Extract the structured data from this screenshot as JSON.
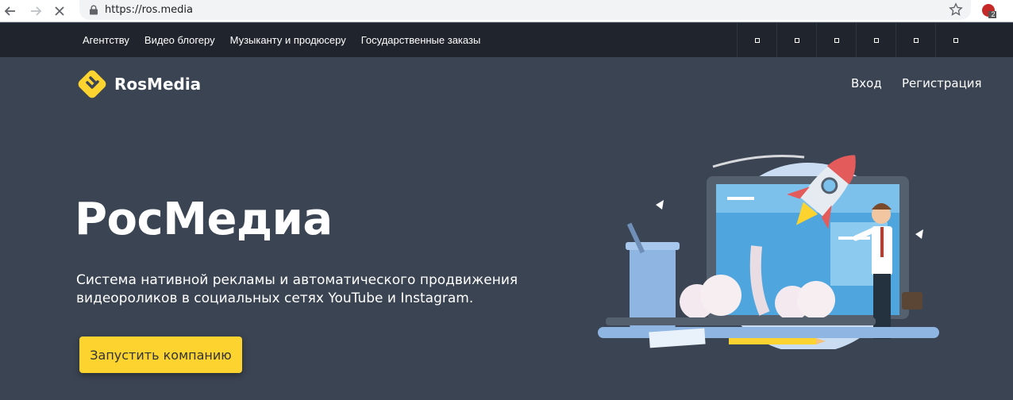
{
  "browser": {
    "url": "https://ros.media",
    "extension_badge": "2"
  },
  "topnav": {
    "items": [
      "Агентству",
      "Видео блогеру",
      "Музыканту и продюсеру",
      "Государственные заказы"
    ]
  },
  "social": {
    "icons": [
      "social-icon-1",
      "social-icon-2",
      "social-icon-3",
      "social-icon-4",
      "social-icon-5",
      "social-icon-6"
    ]
  },
  "header": {
    "logo_text": "RosMedia",
    "login_label": "Вход",
    "register_label": "Регистрация"
  },
  "hero": {
    "title": "РосМедиа",
    "description": "Система нативной рекламы и автоматического продвижения видеороликов в социальных сетях YouTube и Instagram.",
    "cta_label": "Запустить компанию"
  },
  "colors": {
    "background": "#3b4453",
    "topbar": "#20252d",
    "accent": "#fdd330"
  }
}
